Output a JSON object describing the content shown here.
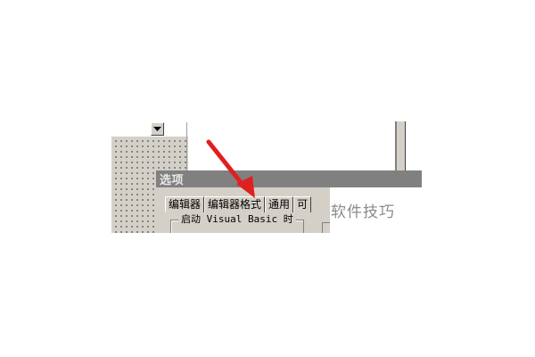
{
  "dialog": {
    "title": "选项",
    "tabs": [
      {
        "label": "编辑器"
      },
      {
        "label": "编辑器格式"
      },
      {
        "label": "通用"
      },
      {
        "label": "可"
      }
    ],
    "group_label": "启动 Visual Basic 时"
  },
  "watermark": {
    "text": "软件技巧"
  },
  "icons": {
    "dropdown": "chevron-down-icon",
    "annotation": "red-arrow-icon"
  },
  "colors": {
    "annotation_arrow": "#e02020",
    "dialog_face": "#d4d0c8",
    "titlebar_inactive": "#808080"
  }
}
